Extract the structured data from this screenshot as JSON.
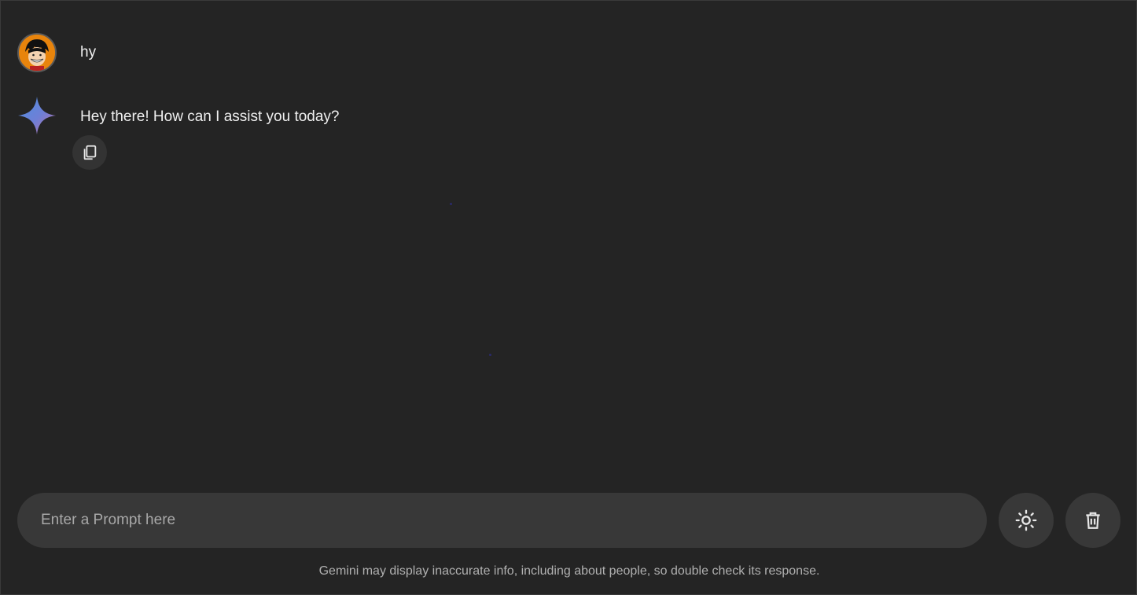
{
  "conversation": {
    "user_message": {
      "text": "hy",
      "avatar_icon": "luffy-avatar-icon"
    },
    "bot_message": {
      "text": "Hey there! How can I assist you today?",
      "avatar_icon": "gemini-sparkle-icon",
      "copy_icon": "copy-icon"
    }
  },
  "input": {
    "placeholder": "Enter a Prompt here",
    "value": ""
  },
  "actions": {
    "theme_icon": "sun-icon",
    "delete_icon": "trash-icon"
  },
  "footer": {
    "disclaimer": "Gemini may display inaccurate info, including about people, so double check its response."
  },
  "colors": {
    "background": "#242424",
    "surface": "#383838",
    "gemini_blue": "#4a90e2",
    "gemini_purple": "#9b72cb"
  }
}
